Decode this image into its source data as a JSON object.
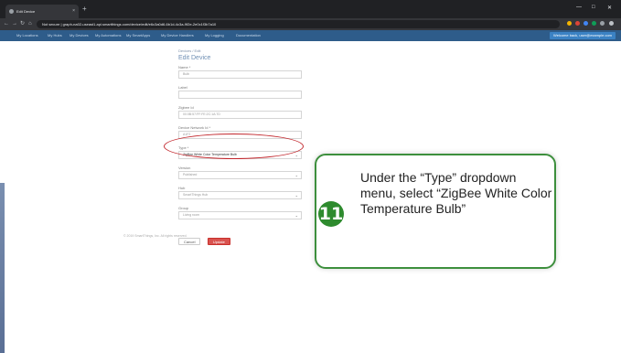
{
  "browser": {
    "tab_title": "Edit Device",
    "tab_close": "×",
    "new_tab": "+",
    "window_controls": [
      "—",
      "□",
      "✕"
    ],
    "nav": [
      "←",
      "→",
      "↻",
      "⌂"
    ],
    "url": "Not secure | graph-na02-useast1.api.smartthings.com/device/edit/e6c3a0d6-6b1d-4c3a-9f2e-2e0c1f3b7a10"
  },
  "site_nav": {
    "items": [
      "My Locations",
      "My Hubs",
      "My Devices",
      "My Automations",
      "My SmartApps",
      "My Device Handlers",
      "My Logging",
      "Documentation"
    ],
    "user": "Welcome back, user@example.com"
  },
  "form": {
    "breadcrumb": "Devices / Edit",
    "title": "Edit Device",
    "fields": [
      {
        "label": "Name *",
        "value": "Bulb"
      },
      {
        "label": "Label",
        "value": ""
      },
      {
        "label": "Zigbee Id",
        "value": "00:0B:57:FF:FE:2C:1A:7D"
      },
      {
        "label": "Device Network Id *",
        "value": "A1F2"
      },
      {
        "label": "Type *",
        "value": "ZigBee White Color Temperature Bulb"
      },
      {
        "label": "Version",
        "value": "Published"
      },
      {
        "label": "Hub",
        "value": "SmartThings Hub"
      },
      {
        "label": "Group",
        "value": "Living room"
      }
    ],
    "cancel": "Cancel",
    "update": "Update"
  },
  "footer": "© 2019 SmartThings, Inc. All rights reserved.",
  "callout": {
    "step": "11",
    "text": "Under the “Type” dropdown menu, select “ZigBee White Color Temperature Bulb”"
  },
  "colors": {
    "accent_green": "#3d8f3d",
    "step_badge": "#2e8b2e",
    "highlight_red": "#c2272d",
    "nav_blue": "#2e5c8a"
  }
}
